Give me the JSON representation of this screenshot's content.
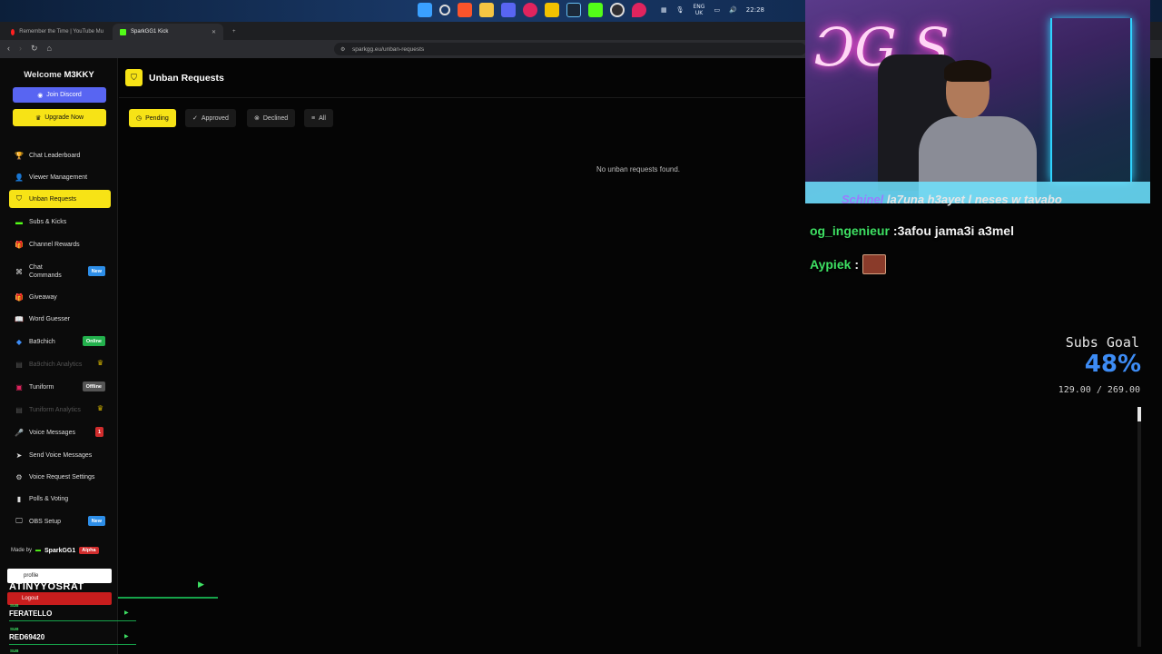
{
  "taskbar": {
    "lang": "ENG",
    "region": "UK",
    "time": "22:28"
  },
  "browser": {
    "tabs": [
      {
        "label": "Remember the Time | YouTube Mu"
      },
      {
        "label": "SparkGG1 Kick"
      }
    ],
    "url": "sparkgg.eu/unban-requests"
  },
  "sidebar": {
    "welcome_prefix": "Welcome",
    "username": "M3KKY",
    "join_discord": "Join Discord",
    "upgrade": "Upgrade Now",
    "items": [
      {
        "label": "Chat Leaderboard"
      },
      {
        "label": "Viewer Management"
      },
      {
        "label": "Unban Requests"
      },
      {
        "label": "Subs & Kicks"
      },
      {
        "label": "Channel Rewards"
      },
      {
        "label": "Chat Commands",
        "badge": "New"
      },
      {
        "label": "Giveaway"
      },
      {
        "label": "Word Guesser"
      },
      {
        "label": "Ba9chich",
        "badge": "Online"
      },
      {
        "label": "Ba9chich Analytics"
      },
      {
        "label": "Tuniform",
        "badge": "Offline"
      },
      {
        "label": "Tuniform Analytics"
      },
      {
        "label": "Voice Messages",
        "badge": "1"
      },
      {
        "label": "Send Voice Messages"
      },
      {
        "label": "Voice Request Settings"
      },
      {
        "label": "Polls & Voting"
      },
      {
        "label": "OBS Setup",
        "badge": "New"
      }
    ],
    "made_by": "Made by",
    "brand": "SparkGG1",
    "alpha": "Alpha"
  },
  "main": {
    "title": "Unban Requests",
    "filters": [
      {
        "label": "Pending"
      },
      {
        "label": "Approved"
      },
      {
        "label": "Declined"
      },
      {
        "label": "All"
      }
    ],
    "empty_message": "No unban requests found."
  },
  "chat": {
    "top_user": "Schinel",
    "top_message": "la7una h3ayet l neses w tavabo",
    "lines": [
      {
        "user": "og_ingenieur",
        "message": ":3afou jama3i a3mel"
      },
      {
        "user": "Aypiek",
        "message": ":"
      }
    ]
  },
  "subs_goal": {
    "title": "Subs Goal",
    "percent_text": "48%",
    "progress": "129.00 / 269.00",
    "fraction": 0.48
  },
  "overlay": {
    "profile": "profile",
    "name1": "ATINYYOSRAT",
    "logout": "Logout",
    "sub_tag": "SUB",
    "name2": "FERATELLO",
    "name3": "RED69420"
  },
  "colors": {
    "accent": "#f7e316",
    "discord": "#5865f2",
    "online": "#23b14d",
    "goal": "#3d8cf5"
  }
}
